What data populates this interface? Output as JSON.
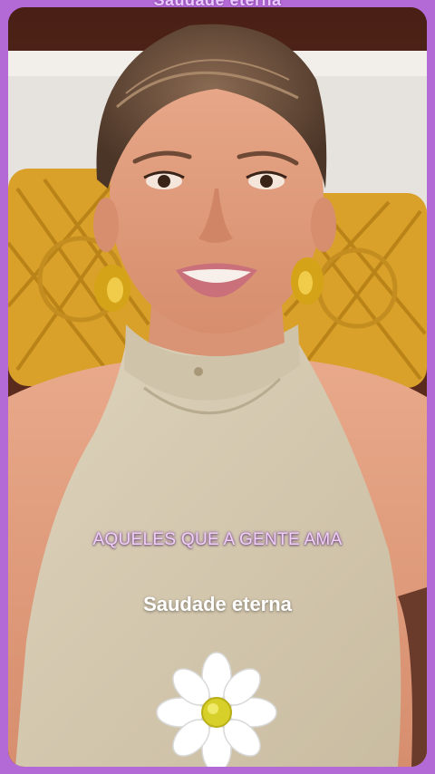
{
  "top_caption": "Saudade eterna",
  "captions": {
    "main": "AQUELES QUE A GENTE AMA",
    "sub": "Saudade eterna"
  },
  "colors": {
    "frame_border": "#b46ad6",
    "caption_main": "#f0cff8",
    "caption_sub": "#ffffff",
    "pillow": "#d9a02a",
    "blouse": "#d8ccb4"
  },
  "sticker": "daisy-flower"
}
